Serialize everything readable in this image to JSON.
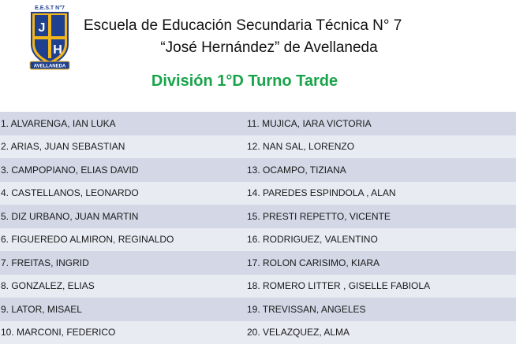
{
  "header": {
    "logo_top_text": "E.E.S.T N°7",
    "logo_letter_1": "J",
    "logo_letter_2": "H",
    "logo_banner": "AVELLANEDA",
    "title_line_1": "Escuela de Educación Secundaria Técnica N° 7",
    "title_line_2": "“José Hernández” de Avellaneda",
    "division": "División 1°D Turno Tarde"
  },
  "colors": {
    "division_green": "#19a44a",
    "row_light": "#e9ebf3",
    "row_dark": "#d3d7e6",
    "shield_blue": "#1f3f8f",
    "shield_gold": "#f2b51b"
  },
  "students": [
    [
      "1. ALVARENGA, IAN LUKA",
      "11. MUJICA, IARA VICTORIA"
    ],
    [
      "2. ARIAS, JUAN SEBASTIAN",
      "12. NAN SAL, LORENZO"
    ],
    [
      "3. CAMPOPIANO, ELIAS DAVID",
      "13. OCAMPO, TIZIANA"
    ],
    [
      "4. CASTELLANOS, LEONARDO",
      "14. PAREDES ESPINDOLA , ALAN"
    ],
    [
      "5. DIZ URBANO, JUAN MARTIN",
      "15. PRESTI REPETTO, VICENTE"
    ],
    [
      "6. FIGUEREDO ALMIRON, REGINALDO",
      "16. RODRIGUEZ, VALENTINO"
    ],
    [
      "7. FREITAS, INGRID",
      "17. ROLON CARISIMO, KIARA"
    ],
    [
      "8. GONZALEZ, ELIAS",
      "18. ROMERO LITTER , GISELLE FABIOLA"
    ],
    [
      "9. LATOR, MISAEL",
      "19. TREVISSAN, ANGELES"
    ],
    [
      "10. MARCONI, FEDERICO",
      "20. VELAZQUEZ, ALMA"
    ]
  ]
}
